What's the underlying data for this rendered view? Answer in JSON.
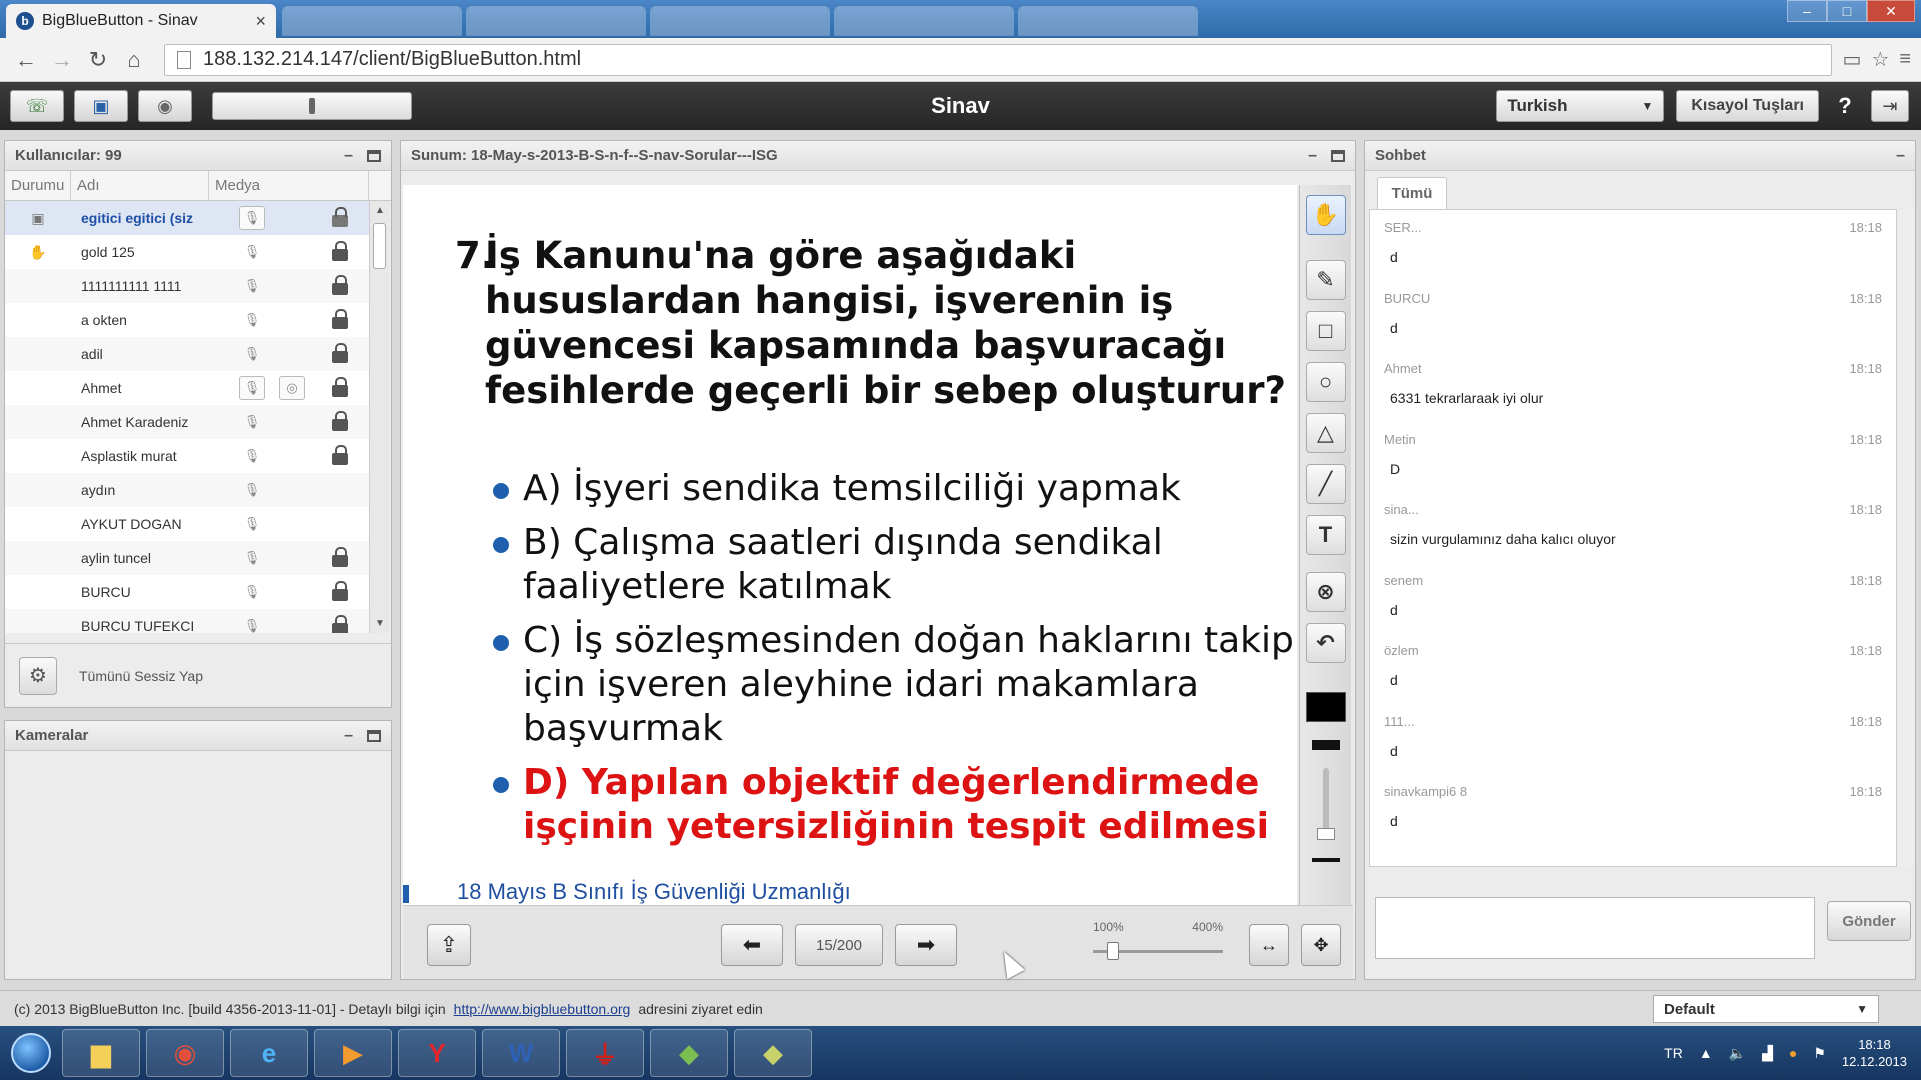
{
  "browser": {
    "tab_title": "BigBlueButton - Sinav",
    "tab_close": "×",
    "url": "188.132.214.147/client/BigBlueButton.html"
  },
  "toolbar": {
    "title": "Sinav",
    "language": "Turkish",
    "shortcut_label": "Kısayol Tuşları",
    "help": "?"
  },
  "users_panel": {
    "title": "Kullanıcılar: 99",
    "columns": [
      "Durumu",
      "Adı",
      "Medya"
    ],
    "rows": [
      {
        "name": "egitici egitici (siz",
        "status": "presenter",
        "lock": "open",
        "selected": true,
        "mic_boxed": true,
        "cam": false
      },
      {
        "name": "gold 125",
        "status": "hand",
        "lock": "closed"
      },
      {
        "name": "1111111111 1111",
        "lock": "closed"
      },
      {
        "name": "a okten",
        "lock": "closed"
      },
      {
        "name": "adil",
        "lock": "closed"
      },
      {
        "name": "Ahmet",
        "lock": "closed",
        "mic_boxed": true,
        "cam": true
      },
      {
        "name": "Ahmet Karadeniz",
        "lock": "closed"
      },
      {
        "name": "Asplastik murat",
        "lock": "closed"
      },
      {
        "name": "aydın",
        "lock": "none"
      },
      {
        "name": "AYKUT DOGAN",
        "lock": "none"
      },
      {
        "name": "aylin tuncel",
        "lock": "closed"
      },
      {
        "name": "BURCU",
        "lock": "closed"
      },
      {
        "name": "BURCU TUFEKCI",
        "lock": "closed"
      }
    ],
    "mute_all_label": "Tümünü Sessiz Yap"
  },
  "cameras_panel": {
    "title": "Kameralar"
  },
  "presentation": {
    "title": "Sunum: 18-May-s-2013-B-S-n-f--S-nav-Sorular---ISG",
    "question_number": "7.",
    "question": "İş Kanunu'na göre aşağıdaki hususlardan hangisi, işverenin iş güvencesi kapsamında başvuracağı fesihlerde geçerli bir sebep oluşturur?",
    "options": [
      {
        "text": "A) İşyeri sendika temsilciliği yapmak",
        "correct": false
      },
      {
        "text": "B) Çalışma saatleri dışında sendikal\nfaaliyetlere katılmak",
        "correct": false
      },
      {
        "text": "C) İş sözleşmesinden doğan haklarını takip\niçin işveren aleyhine idari makamlara\nbaşvurmak",
        "correct": false
      },
      {
        "text": "D) Yapılan objektif değerlendirmede\nişçinin yetersizliğinin tespit edilmesi",
        "correct": true
      }
    ],
    "footer_text": "18 Mayıs B Sınıfı İş Güvenliği Uzmanlığı",
    "page_indicator": "15/200",
    "zoom_min": "100%",
    "zoom_max": "400%",
    "zoom_level_fraction": 0.15,
    "colors": {
      "correct": "#dd1212",
      "bullet": "#1f5fae"
    }
  },
  "whiteboard_tools": [
    "hand-icon",
    "pencil-icon",
    "rectangle-icon",
    "ellipse-icon",
    "triangle-icon",
    "line-icon",
    "text-icon",
    "clear-icon",
    "undo-icon"
  ],
  "chat": {
    "title": "Sohbet",
    "tab": "Tümü",
    "messages": [
      {
        "sender": "SER...",
        "time": "18:18",
        "text": "d"
      },
      {
        "sender": "BURCU",
        "time": "18:18",
        "text": "d"
      },
      {
        "sender": "Ahmet",
        "time": "18:18",
        "text": "6331 tekrarlaraak iyi olur"
      },
      {
        "sender": "Metin",
        "time": "18:18",
        "text": "D"
      },
      {
        "sender": "sina...",
        "time": "18:18",
        "text": "sizin vurgulamınız daha kalıcı oluyor"
      },
      {
        "sender": "senem",
        "time": "18:18",
        "text": "d"
      },
      {
        "sender": "özlem",
        "time": "18:18",
        "text": "d"
      },
      {
        "sender": "111...",
        "time": "18:18",
        "text": "d"
      },
      {
        "sender": "sinavkampi6 8",
        "time": "18:18",
        "text": "d"
      }
    ],
    "input_placeholder": "",
    "send_label": "Gönder"
  },
  "footer": {
    "copyright": "(c) 2013 BigBlueButton Inc. [build 4356-2013-11-01] - Detaylı bilgi için",
    "link": "http://www.bigbluebutton.org",
    "suffix": "adresini ziyaret edin",
    "layout": "Default"
  },
  "taskbar": {
    "language": "TR",
    "time": "18:18",
    "date": "12.12.2013"
  }
}
